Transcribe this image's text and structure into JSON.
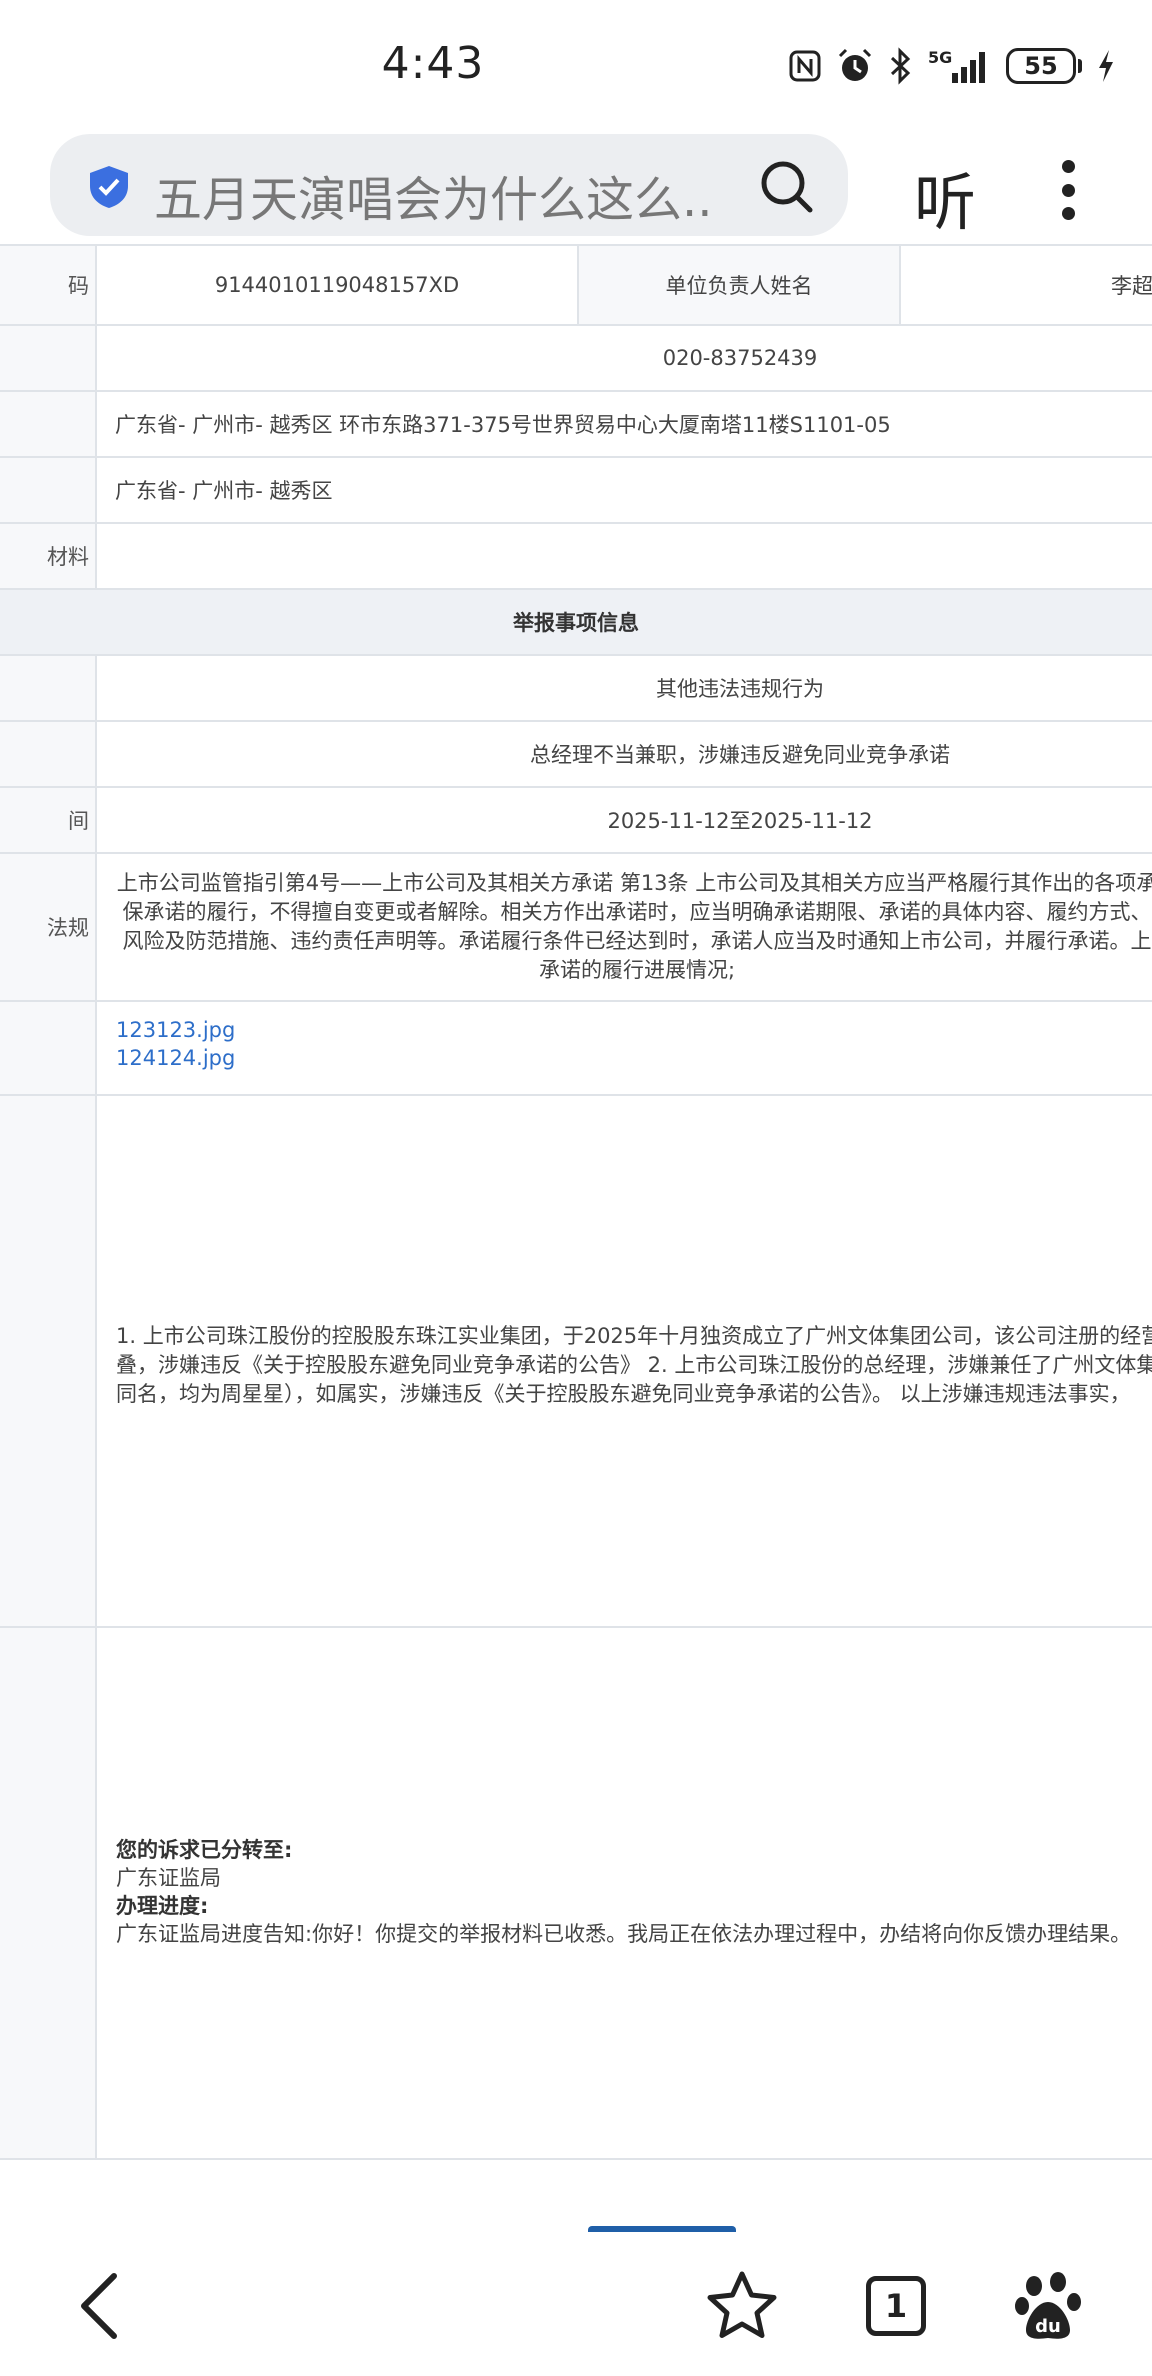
{
  "status_bar": {
    "time": "4:43",
    "battery": "55",
    "icons": [
      "nfc-icon",
      "alarm-icon",
      "bluetooth-icon",
      "5g-signal-icon",
      "battery-icon",
      "charging-icon"
    ]
  },
  "browser": {
    "search_text": "五月天演唱会为什么这么...",
    "listen_label": "听",
    "accent_color": "#3b6fe0"
  },
  "form": {
    "rows": [
      {
        "label": "码",
        "credit_code": "9144010119048157XD",
        "head_label": "单位负责人姓名",
        "head_value": "李超"
      },
      {
        "label": "",
        "value": "020-83752439"
      },
      {
        "label": "",
        "value": "广东省- 广州市- 越秀区 环市东路371-375号世界贸易中心大厦南塔11楼S1101-05"
      },
      {
        "label": "",
        "value": "广东省- 广州市- 越秀区"
      },
      {
        "label": "材料",
        "value": ""
      }
    ],
    "section_title": "举报事项信息",
    "report_rows": [
      {
        "label": "",
        "value": "其他违法违规行为"
      },
      {
        "label": "",
        "value": "总经理不当兼职，涉嫌违反避免同业竞争承诺"
      },
      {
        "label": "间",
        "value": "2025-11-12至2025-11-12"
      }
    ],
    "law": {
      "label": "法规",
      "lines": [
        "上市公司监管指引第4号——上市公司及其相关方承诺 第13条 上市公司及其相关方应当严格履行其作出的各项承",
        "保承诺的履行，不得擅自变更或者解除。相关方作出承诺时，应当明确承诺期限、承诺的具体内容、履约方式、",
        "风险及防范措施、违约责任声明等。承诺履行条件已经达到时，承诺人应当及时通知上市公司，并履行承诺。上",
        "承诺的履行进展情况;"
      ]
    },
    "attachments": [
      "123123.jpg",
      "124124.jpg"
    ],
    "description_lines": [
      "1. 上市公司珠江股份的控股股东珠江实业集团，于2025年十月独资成立了广州文体集团公司，该公司注册的经营",
      "叠，涉嫌违反《关于控股股东避免同业竞争承诺的公告》 2. 上市公司珠江股份的总经理，涉嫌兼任了广州文体集",
      "同名，均为周星星），如属实，涉嫌违反《关于控股股东避免同业竞争承诺的公告》。 以上涉嫌违规违法事实，"
    ],
    "reply": {
      "transfer_label": "您的诉求已分转至:",
      "transfer_value": "广东证监局",
      "progress_label": "办理进度:",
      "progress_value": "广东证监局进度告知:你好！你提交的举报材料已收悉。我局正在依法办理过程中，办结将向你反馈办理结果。"
    }
  },
  "bottom_nav": {
    "tab_count": "1",
    "icons": [
      "back-arrow-icon",
      "star-icon",
      "tabs-icon",
      "baidu-paw-icon"
    ]
  }
}
